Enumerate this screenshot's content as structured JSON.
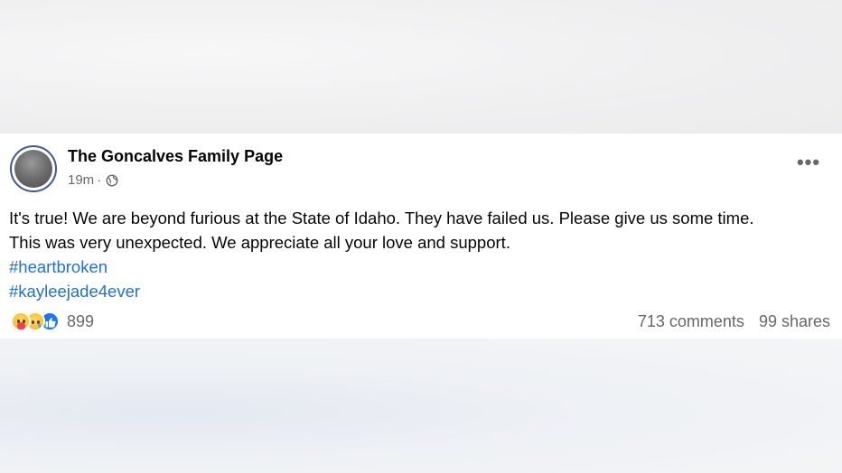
{
  "post": {
    "page_name": "The Goncalves Family Page",
    "time": "19m",
    "separator": "·",
    "visibility_icon": "globe-icon",
    "more_icon": "more-options-icon",
    "more_label": "•••",
    "text_lines": [
      "It's true! We are beyond furious at the State of Idaho. They have failed us. Please give us some time.",
      "This was very unexpected. We appreciate all your love and support."
    ],
    "hashtags": [
      "#heartbroken",
      "#kayleejade4ever"
    ],
    "reactions": {
      "icons": [
        "care-reaction-icon",
        "sad-reaction-icon",
        "like-reaction-icon"
      ],
      "count": "899"
    },
    "comments": "713 comments",
    "shares": "99 shares"
  },
  "colors": {
    "hashtag": "#216fdb",
    "meta_text": "#65676b",
    "like_blue": "#1877f2"
  }
}
